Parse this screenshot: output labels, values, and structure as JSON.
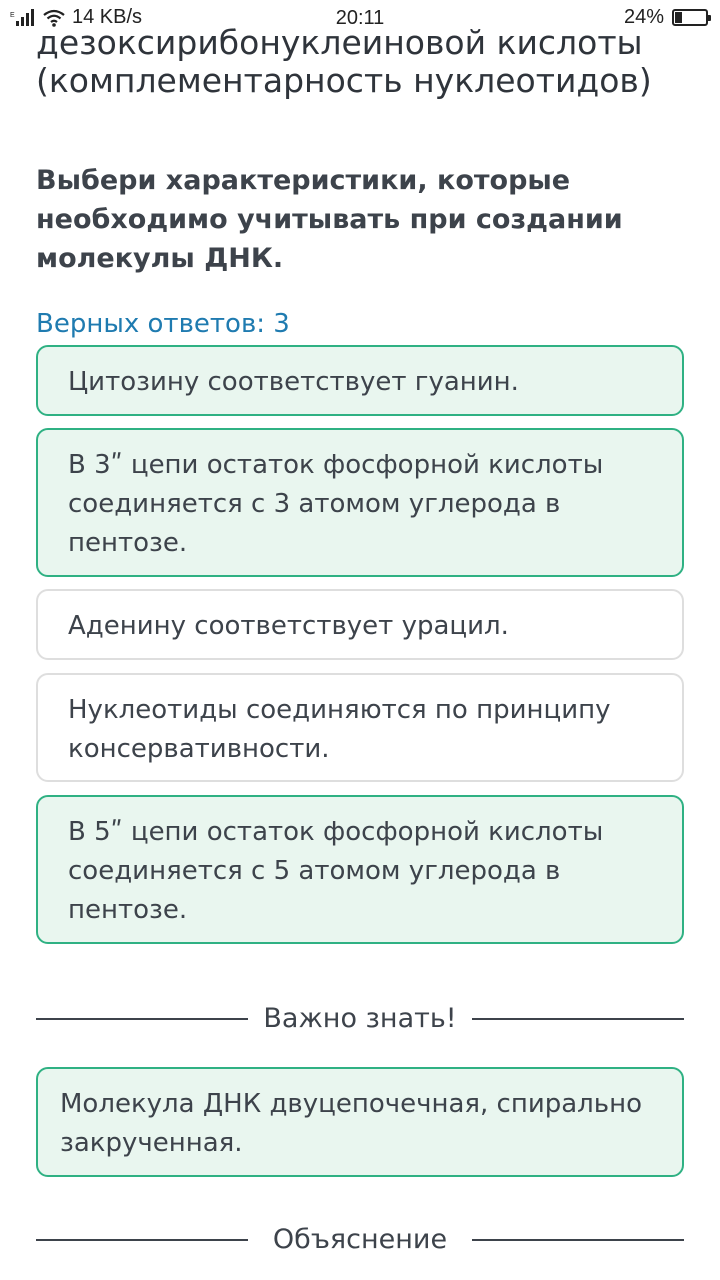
{
  "status": {
    "speed": "14 KB/s",
    "time": "20:11",
    "battery": "24%",
    "battery_level": 0.24
  },
  "lesson": {
    "title": "дезоксирибонуклеиновой кислоты (комплементарность нуклеотидов)"
  },
  "question": {
    "text": "Выбери характеристики, которые необходимо учитывать при создании молекулы ДНК.",
    "answers_count": "Верных ответов: 3"
  },
  "options": [
    {
      "text": "Цитозину соответствует гуанин.",
      "selected": true
    },
    {
      "text": "В 3ʺ цепи остаток фосфорной кислоты соединяется с 3 атомом углерода в пентозе.",
      "selected": true
    },
    {
      "text": "Аденину соответствует урацил.",
      "selected": false
    },
    {
      "text": "Нуклеотиды соединяются по принципу консервативности.",
      "selected": false
    },
    {
      "text": "В 5ʺ цепи остаток фосфорной кислоты соединяется с 5 атомом углерода в пентозе.",
      "selected": true
    }
  ],
  "important": {
    "heading": "Важно знать!",
    "text": "Молекула ДНК двуцепочечная, спирально закрученная."
  },
  "explanation": {
    "heading": "Объяснение"
  }
}
